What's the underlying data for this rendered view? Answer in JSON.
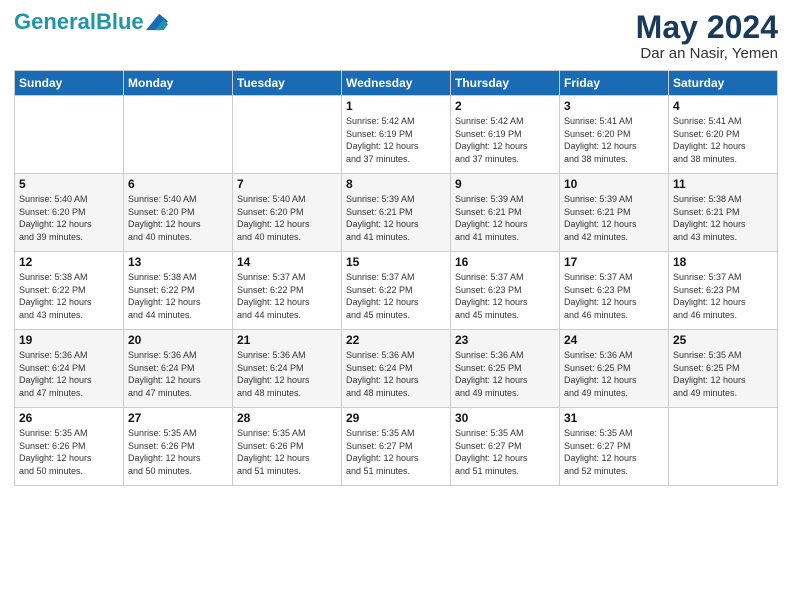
{
  "header": {
    "logo_line1": "General",
    "logo_line2": "Blue",
    "main_title": "May 2024",
    "subtitle": "Dar an Nasir, Yemen"
  },
  "days_of_week": [
    "Sunday",
    "Monday",
    "Tuesday",
    "Wednesday",
    "Thursday",
    "Friday",
    "Saturday"
  ],
  "weeks": [
    [
      {
        "day": "",
        "info": ""
      },
      {
        "day": "",
        "info": ""
      },
      {
        "day": "",
        "info": ""
      },
      {
        "day": "1",
        "info": "Sunrise: 5:42 AM\nSunset: 6:19 PM\nDaylight: 12 hours\nand 37 minutes."
      },
      {
        "day": "2",
        "info": "Sunrise: 5:42 AM\nSunset: 6:19 PM\nDaylight: 12 hours\nand 37 minutes."
      },
      {
        "day": "3",
        "info": "Sunrise: 5:41 AM\nSunset: 6:20 PM\nDaylight: 12 hours\nand 38 minutes."
      },
      {
        "day": "4",
        "info": "Sunrise: 5:41 AM\nSunset: 6:20 PM\nDaylight: 12 hours\nand 38 minutes."
      }
    ],
    [
      {
        "day": "5",
        "info": "Sunrise: 5:40 AM\nSunset: 6:20 PM\nDaylight: 12 hours\nand 39 minutes."
      },
      {
        "day": "6",
        "info": "Sunrise: 5:40 AM\nSunset: 6:20 PM\nDaylight: 12 hours\nand 40 minutes."
      },
      {
        "day": "7",
        "info": "Sunrise: 5:40 AM\nSunset: 6:20 PM\nDaylight: 12 hours\nand 40 minutes."
      },
      {
        "day": "8",
        "info": "Sunrise: 5:39 AM\nSunset: 6:21 PM\nDaylight: 12 hours\nand 41 minutes."
      },
      {
        "day": "9",
        "info": "Sunrise: 5:39 AM\nSunset: 6:21 PM\nDaylight: 12 hours\nand 41 minutes."
      },
      {
        "day": "10",
        "info": "Sunrise: 5:39 AM\nSunset: 6:21 PM\nDaylight: 12 hours\nand 42 minutes."
      },
      {
        "day": "11",
        "info": "Sunrise: 5:38 AM\nSunset: 6:21 PM\nDaylight: 12 hours\nand 43 minutes."
      }
    ],
    [
      {
        "day": "12",
        "info": "Sunrise: 5:38 AM\nSunset: 6:22 PM\nDaylight: 12 hours\nand 43 minutes."
      },
      {
        "day": "13",
        "info": "Sunrise: 5:38 AM\nSunset: 6:22 PM\nDaylight: 12 hours\nand 44 minutes."
      },
      {
        "day": "14",
        "info": "Sunrise: 5:37 AM\nSunset: 6:22 PM\nDaylight: 12 hours\nand 44 minutes."
      },
      {
        "day": "15",
        "info": "Sunrise: 5:37 AM\nSunset: 6:22 PM\nDaylight: 12 hours\nand 45 minutes."
      },
      {
        "day": "16",
        "info": "Sunrise: 5:37 AM\nSunset: 6:23 PM\nDaylight: 12 hours\nand 45 minutes."
      },
      {
        "day": "17",
        "info": "Sunrise: 5:37 AM\nSunset: 6:23 PM\nDaylight: 12 hours\nand 46 minutes."
      },
      {
        "day": "18",
        "info": "Sunrise: 5:37 AM\nSunset: 6:23 PM\nDaylight: 12 hours\nand 46 minutes."
      }
    ],
    [
      {
        "day": "19",
        "info": "Sunrise: 5:36 AM\nSunset: 6:24 PM\nDaylight: 12 hours\nand 47 minutes."
      },
      {
        "day": "20",
        "info": "Sunrise: 5:36 AM\nSunset: 6:24 PM\nDaylight: 12 hours\nand 47 minutes."
      },
      {
        "day": "21",
        "info": "Sunrise: 5:36 AM\nSunset: 6:24 PM\nDaylight: 12 hours\nand 48 minutes."
      },
      {
        "day": "22",
        "info": "Sunrise: 5:36 AM\nSunset: 6:24 PM\nDaylight: 12 hours\nand 48 minutes."
      },
      {
        "day": "23",
        "info": "Sunrise: 5:36 AM\nSunset: 6:25 PM\nDaylight: 12 hours\nand 49 minutes."
      },
      {
        "day": "24",
        "info": "Sunrise: 5:36 AM\nSunset: 6:25 PM\nDaylight: 12 hours\nand 49 minutes."
      },
      {
        "day": "25",
        "info": "Sunrise: 5:35 AM\nSunset: 6:25 PM\nDaylight: 12 hours\nand 49 minutes."
      }
    ],
    [
      {
        "day": "26",
        "info": "Sunrise: 5:35 AM\nSunset: 6:26 PM\nDaylight: 12 hours\nand 50 minutes."
      },
      {
        "day": "27",
        "info": "Sunrise: 5:35 AM\nSunset: 6:26 PM\nDaylight: 12 hours\nand 50 minutes."
      },
      {
        "day": "28",
        "info": "Sunrise: 5:35 AM\nSunset: 6:26 PM\nDaylight: 12 hours\nand 51 minutes."
      },
      {
        "day": "29",
        "info": "Sunrise: 5:35 AM\nSunset: 6:27 PM\nDaylight: 12 hours\nand 51 minutes."
      },
      {
        "day": "30",
        "info": "Sunrise: 5:35 AM\nSunset: 6:27 PM\nDaylight: 12 hours\nand 51 minutes."
      },
      {
        "day": "31",
        "info": "Sunrise: 5:35 AM\nSunset: 6:27 PM\nDaylight: 12 hours\nand 52 minutes."
      },
      {
        "day": "",
        "info": ""
      }
    ]
  ]
}
